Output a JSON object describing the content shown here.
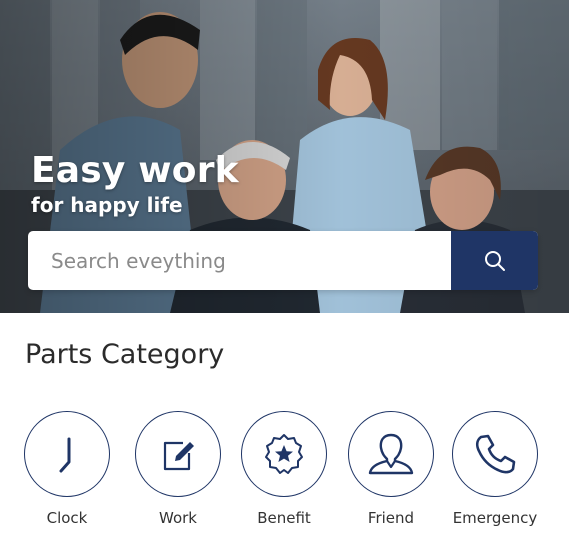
{
  "hero": {
    "title": "Easy work",
    "subtitle": "for happy life"
  },
  "search": {
    "placeholder": "Search eveything",
    "button_icon": "search-icon"
  },
  "categories_section": {
    "title": "Parts Category",
    "items": [
      {
        "label": "Clock",
        "icon": "clock-icon"
      },
      {
        "label": "Work",
        "icon": "edit-icon"
      },
      {
        "label": "Benefit",
        "icon": "star-badge-icon"
      },
      {
        "label": "Friend",
        "icon": "person-icon"
      },
      {
        "label": "Emergency",
        "icon": "phone-icon"
      }
    ]
  },
  "colors": {
    "primary": "#1f3566",
    "text": "#2b2b2b",
    "hero_text": "#ffffff"
  }
}
